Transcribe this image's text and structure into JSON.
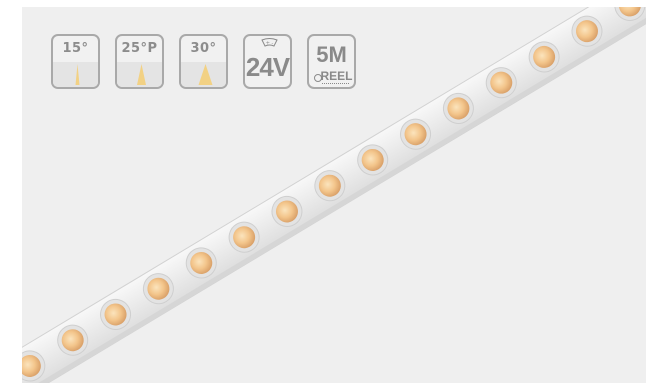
{
  "badges": [
    {
      "label": "15°",
      "icon": "beam-15-icon",
      "beam_angle": 15
    },
    {
      "label": "25°P",
      "icon": "beam-25-icon",
      "beam_angle": 25
    },
    {
      "label": "30°",
      "icon": "beam-30-icon",
      "beam_angle": 30
    },
    {
      "label": "24V",
      "icon": "voltage-icon"
    },
    {
      "label": "5M",
      "sublabel": "REEL",
      "icon": "reel-icon"
    }
  ],
  "product": {
    "name": "LED strip",
    "colors": {
      "strip": "#ebebeb",
      "led": "#f3c58b",
      "beam": "#f3d489",
      "border": "#a9a9a9"
    }
  }
}
